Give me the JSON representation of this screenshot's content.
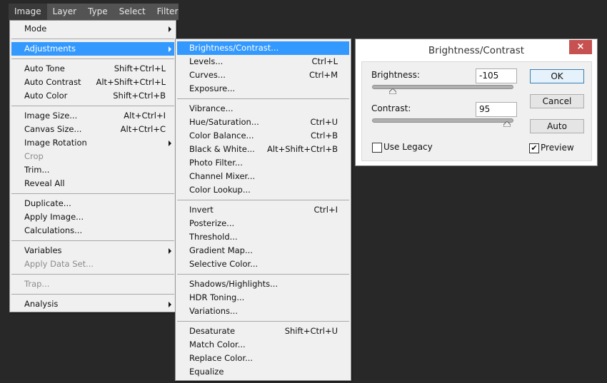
{
  "menubar": {
    "items": [
      "Image",
      "Layer",
      "Type",
      "Select",
      "Filter"
    ],
    "active": "Image"
  },
  "image_menu": [
    {
      "label": "Mode",
      "submenu": true
    },
    {
      "separator": true
    },
    {
      "label": "Adjustments",
      "submenu": true,
      "highlighted": true
    },
    {
      "separator": true
    },
    {
      "label": "Auto Tone",
      "shortcut": "Shift+Ctrl+L"
    },
    {
      "label": "Auto Contrast",
      "shortcut": "Alt+Shift+Ctrl+L"
    },
    {
      "label": "Auto Color",
      "shortcut": "Shift+Ctrl+B"
    },
    {
      "separator": true
    },
    {
      "label": "Image Size...",
      "shortcut": "Alt+Ctrl+I"
    },
    {
      "label": "Canvas Size...",
      "shortcut": "Alt+Ctrl+C"
    },
    {
      "label": "Image Rotation",
      "submenu": true
    },
    {
      "label": "Crop",
      "disabled": true
    },
    {
      "label": "Trim..."
    },
    {
      "label": "Reveal All"
    },
    {
      "separator": true
    },
    {
      "label": "Duplicate..."
    },
    {
      "label": "Apply Image..."
    },
    {
      "label": "Calculations..."
    },
    {
      "separator": true
    },
    {
      "label": "Variables",
      "submenu": true
    },
    {
      "label": "Apply Data Set...",
      "disabled": true
    },
    {
      "separator": true
    },
    {
      "label": "Trap...",
      "disabled": true
    },
    {
      "separator": true
    },
    {
      "label": "Analysis",
      "submenu": true
    }
  ],
  "adjustments_menu": [
    {
      "label": "Brightness/Contrast...",
      "highlighted": true
    },
    {
      "label": "Levels...",
      "shortcut": "Ctrl+L"
    },
    {
      "label": "Curves...",
      "shortcut": "Ctrl+M"
    },
    {
      "label": "Exposure..."
    },
    {
      "separator": true
    },
    {
      "label": "Vibrance..."
    },
    {
      "label": "Hue/Saturation...",
      "shortcut": "Ctrl+U"
    },
    {
      "label": "Color Balance...",
      "shortcut": "Ctrl+B"
    },
    {
      "label": "Black & White...",
      "shortcut": "Alt+Shift+Ctrl+B"
    },
    {
      "label": "Photo Filter..."
    },
    {
      "label": "Channel Mixer..."
    },
    {
      "label": "Color Lookup..."
    },
    {
      "separator": true
    },
    {
      "label": "Invert",
      "shortcut": "Ctrl+I"
    },
    {
      "label": "Posterize..."
    },
    {
      "label": "Threshold..."
    },
    {
      "label": "Gradient Map..."
    },
    {
      "label": "Selective Color..."
    },
    {
      "separator": true
    },
    {
      "label": "Shadows/Highlights..."
    },
    {
      "label": "HDR Toning..."
    },
    {
      "label": "Variations..."
    },
    {
      "separator": true
    },
    {
      "label": "Desaturate",
      "shortcut": "Shift+Ctrl+U"
    },
    {
      "label": "Match Color..."
    },
    {
      "label": "Replace Color..."
    },
    {
      "label": "Equalize"
    }
  ],
  "dialog": {
    "title": "Brightness/Contrast",
    "close_icon": "×",
    "brightness_label": "Brightness:",
    "brightness_value": "-105",
    "brightness_range": [
      -150,
      150
    ],
    "contrast_label": "Contrast:",
    "contrast_value": "95",
    "contrast_range": [
      -50,
      100
    ],
    "ok_label": "OK",
    "cancel_label": "Cancel",
    "auto_label": "Auto",
    "use_legacy_label": "Use Legacy",
    "use_legacy_checked": false,
    "preview_label": "Preview",
    "preview_checked": true,
    "check_glyph": "✔"
  },
  "colors": {
    "highlight": "#3399ff",
    "close_button": "#c75050",
    "background": "#282828",
    "menubar": "#535353"
  }
}
